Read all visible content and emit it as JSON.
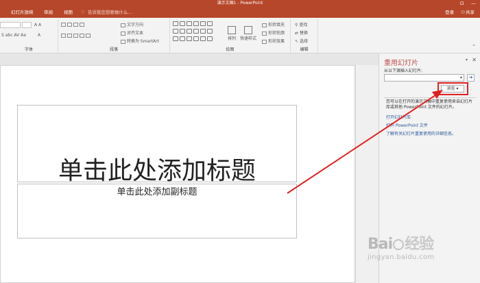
{
  "window": {
    "title": "演示文稿1 - PowerPoint",
    "controls": [
      "⊡",
      "—"
    ]
  },
  "tabs": [
    {
      "label": "幻灯片放映"
    },
    {
      "label": "审阅"
    },
    {
      "label": "视图"
    }
  ],
  "tell_me": {
    "placeholder": "告诉我您想要做什么..."
  },
  "account": {
    "signin": "登录",
    "share": "共享"
  },
  "ribbon": {
    "groups": {
      "font": "字体",
      "paragraph": "段落",
      "drawing": "绘图",
      "editing": "编辑"
    },
    "paragraph_items": {
      "text_direction": "文字方向",
      "align_text": "对齐文本",
      "smartart": "转换为 SmartArt"
    },
    "drawing_items": {
      "arrange": "排列",
      "quick_styles": "快速样式",
      "shape_fill": "形状填充",
      "shape_outline": "形状轮廓",
      "shape_effects": "形状效果"
    },
    "editing_items": {
      "find": "查找",
      "replace": "替换",
      "select": "选择"
    }
  },
  "slide": {
    "title_placeholder": "单击此处添加标题",
    "subtitle_placeholder": "单击此处添加副标题"
  },
  "reuse_pane": {
    "title": "重用幻灯片",
    "insert_from_label": "从以下源插入幻灯片:",
    "insert_from_value": "",
    "browse_button": "浏览 ▾",
    "description": "您可以在打开的演示文稿中重复使用来自幻灯片库或其他 PowerPoint 文件的幻灯片。",
    "links": [
      {
        "label": "打开幻灯片库"
      },
      {
        "label": "打开 PowerPoint 文件"
      },
      {
        "label": "了解有关幻灯片重复使用的详细信息。"
      }
    ]
  },
  "watermark": {
    "brand": "Bai",
    "brand_suffix": "经验",
    "url": "jingyan.baidu.com"
  },
  "colors": {
    "accent": "#b7472a",
    "annotation": "#e02020",
    "link": "#2b579a"
  }
}
